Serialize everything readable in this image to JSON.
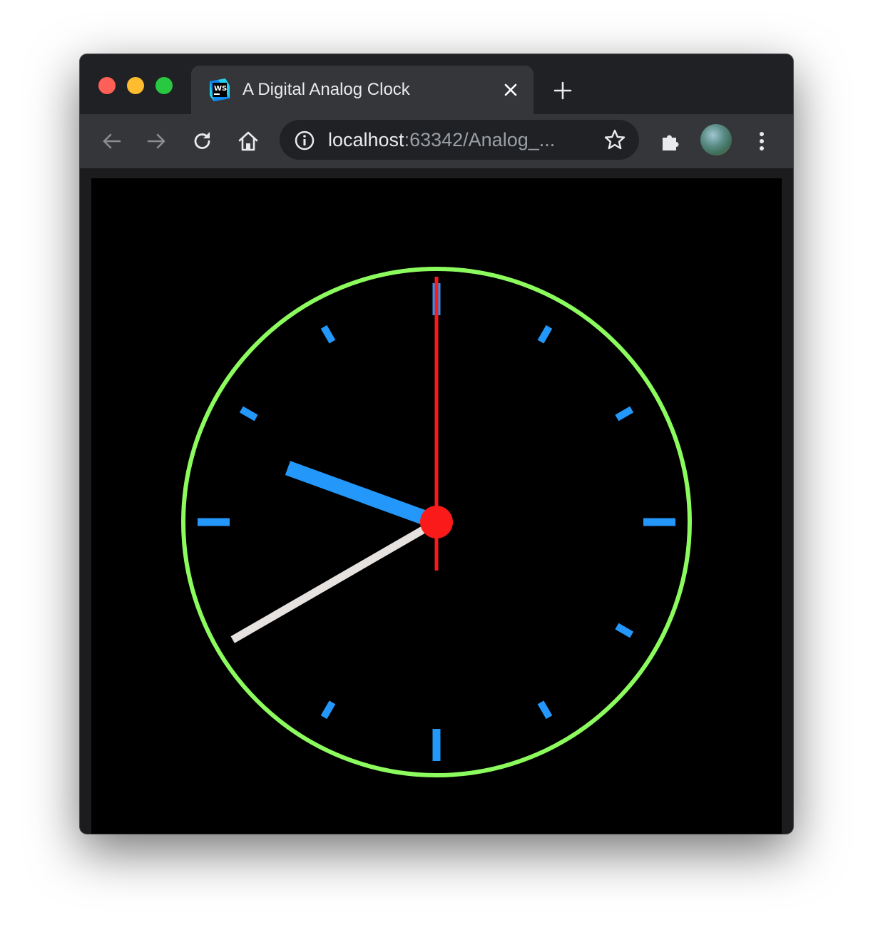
{
  "browser": {
    "tab": {
      "title": "A Digital Analog Clock",
      "favicon": "webstorm-icon"
    },
    "omnibox": {
      "url_host": "localhost",
      "url_rest": ":63342/Analog_..."
    }
  },
  "clock": {
    "time": {
      "hours": 9,
      "minutes": 40,
      "seconds": 0
    },
    "colors": {
      "background": "#000000",
      "dial_ring": "#8cfb5e",
      "tick_marks": "#2397fa",
      "hour_hand": "#2397fa",
      "minute_hand": "#e6e2df",
      "second_hand": "#fb1a1a",
      "center_cap": "#fb1a1a"
    }
  }
}
